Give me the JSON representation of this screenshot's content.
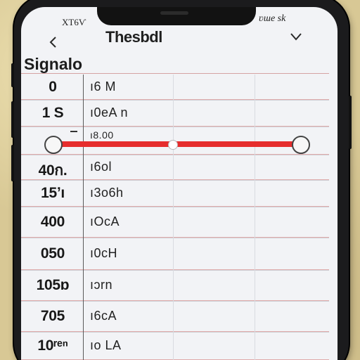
{
  "status": {
    "left": "ХТ6Ѵ",
    "right": "ʋɯe sk"
  },
  "nav": {
    "title": "Thesbdl",
    "back_icon": "chevron-left-icon",
    "menu_icon": "chevron-down-icon"
  },
  "section": {
    "title": "Signalo"
  },
  "rows": [
    {
      "left": "0",
      "right": "ı6 M"
    },
    {
      "left": "1 S",
      "right": "ı0eA n"
    },
    {
      "left": "",
      "right": "ı8.00"
    },
    {
      "left": "40ก.",
      "right": "ı6ol"
    },
    {
      "left": "15ʼı",
      "right": "ı3o6h"
    },
    {
      "left": "400",
      "right": "ıOcA"
    },
    {
      "left": "050",
      "right": "ı0cH"
    },
    {
      "left": "105ɒ",
      "right": "ıɔrn"
    },
    {
      "left": "705",
      "right": "ı6cA"
    },
    {
      "left": "10ʳᵉⁿ",
      "right": "ıo LA"
    }
  ],
  "slider": {
    "value": 0.5,
    "color": "#e62d2d"
  },
  "colors": {
    "screen": "#f2f3f6",
    "divider": "#e0aaaa",
    "background": "#d8c895"
  }
}
